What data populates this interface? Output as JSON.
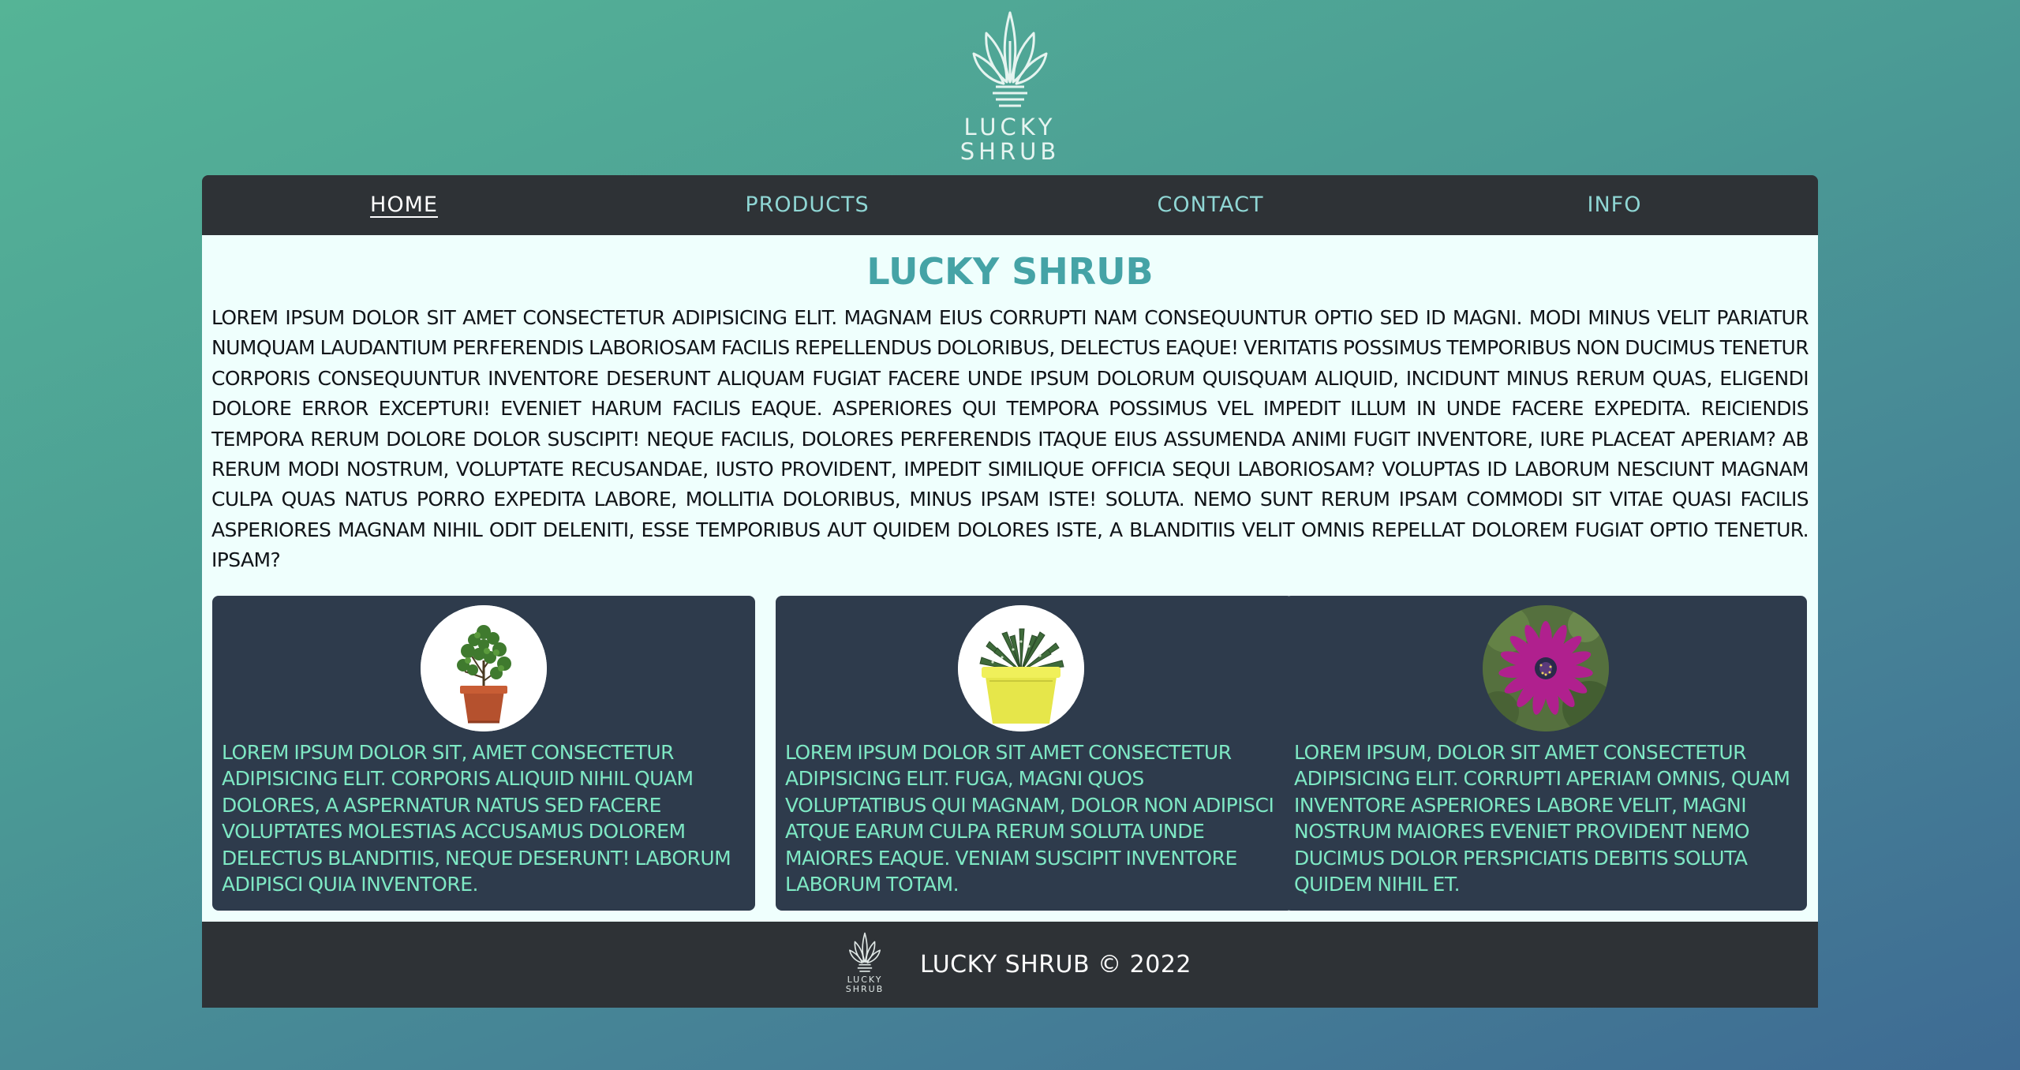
{
  "brand": {
    "logo_line1": "LUCKY",
    "logo_line2": "SHRUB"
  },
  "nav": {
    "items": [
      {
        "label": "Home",
        "active": true
      },
      {
        "label": "Products",
        "active": false
      },
      {
        "label": "Contact",
        "active": false
      },
      {
        "label": "Info",
        "active": false
      }
    ]
  },
  "main": {
    "title": "Lucky Shrub",
    "intro": "Lorem ipsum dolor sit amet consectetur adipisicing elit. Magnam eius corrupti nam consequuntur optio sed id magni. Modi minus velit pariatur numquam laudantium perferendis laboriosam facilis repellendus doloribus, delectus eaque! Veritatis possimus temporibus non ducimus tenetur corporis consequuntur inventore deserunt aliquam fugiat facere unde ipsum dolorum quisquam aliquid, incidunt minus rerum quas, eligendi dolore error excepturi! Eveniet harum facilis eaque. Asperiores qui tempora possimus vel impedit illum in unde facere expedita. Reiciendis tempora rerum dolore dolor suscipit! Neque facilis, dolores perferendis itaque eius assumenda animi fugit inventore, iure placeat aperiam? Ab rerum modi nostrum, voluptate recusandae, iusto provident, impedit similique officia sequi laboriosam? Voluptas id laborum nesciunt magnam culpa quas natus porro expedita labore, mollitia doloribus, minus ipsam iste! Soluta. Nemo sunt rerum ipsam commodi sit vitae quasi facilis asperiores magnam nihil odit deleniti, esse temporibus aut quidem dolores iste, a blanditiis velit omnis repellat dolorem fugiat optio tenetur. Ipsam?"
  },
  "cards": [
    {
      "image": "potted-shrub-terracotta",
      "text": "Lorem ipsum dolor sit, amet consectetur adipisicing elit. Corporis aliquid nihil quam dolores, a aspernatur natus sed facere voluptates molestias accusamus dolorem delectus blanditiis, neque deserunt! Laborum adipisci quia inventore."
    },
    {
      "image": "succulent-yellow-pot",
      "text": "Lorem ipsum dolor sit amet consectetur adipisicing elit. Fuga, magni quos voluptatibus qui magnam, dolor non adipisci atque earum culpa rerum soluta unde maiores eaque. Veniam suscipit inventore laborum totam."
    },
    {
      "image": "purple-daisy-flower",
      "text": "Lorem ipsum, dolor sit amet consectetur adipisicing elit. Corrupti aperiam omnis, quam inventore asperiores labore velit, magni nostrum maiores eveniet provident nemo ducimus dolor perspiciatis debitis soluta quidem nihil et."
    }
  ],
  "footer": {
    "logo_line1": "LUCKY",
    "logo_line2": "SHRUB",
    "copyright": "Lucky Shrub © 2022"
  },
  "colors": {
    "nav_bg": "#2e3236",
    "nav_link": "#8fd6d4",
    "main_bg": "#effffd",
    "title": "#45a3a6",
    "card_bg": "#2e3b4c",
    "card_text": "#7ee8c4"
  }
}
